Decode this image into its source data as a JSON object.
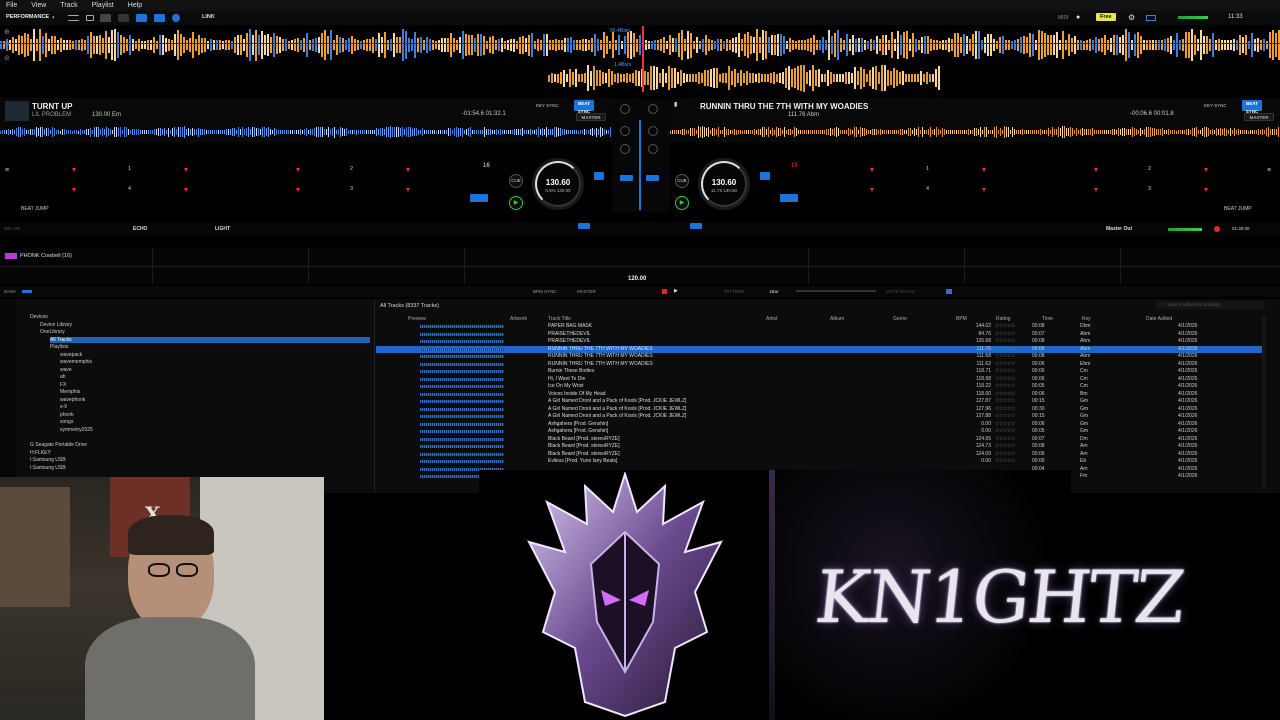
{
  "menu": [
    "File",
    "View",
    "Track",
    "Playlist",
    "Help"
  ],
  "toolbar": {
    "mode": "PERFORMANCE",
    "link": "LINK",
    "midi": "MIDI",
    "free": "Free",
    "clock": "11:33"
  },
  "overview": {
    "bars_top": "56.4Bars",
    "bars_bottom": "1.4Bars"
  },
  "deck_left": {
    "title": "TURNT UP",
    "artist": "LIL PROBLEM",
    "bpm_key": "130.00 Em",
    "time": "-01:54.6  01:32.1",
    "jog_bpm": "130.60",
    "jog_pct": "0.5%  130.00",
    "key_sync": "KEY SYNC",
    "beat_sync": "BEAT SYNC",
    "master": "MASTER",
    "beat_jump": "BEAT JUMP",
    "loop_len": "16"
  },
  "deck_right": {
    "title": "RUNNIN THRU THE 7TH WITH MY WOADIES",
    "bpm_key": "111.76 Abm",
    "time": "-00:06.6  00:01.8",
    "jog_bpm": "130.60",
    "jog_pct": "11.76  130.60",
    "key_sync": "KEY SYNC",
    "beat_sync": "BEAT SYNC",
    "master": "MASTER",
    "beat_jump": "BEAT JUMP",
    "loop_len": "16"
  },
  "cues_left": [
    "1",
    "2",
    "3",
    "4"
  ],
  "cues_right": [
    "1",
    "2",
    "3",
    "4"
  ],
  "fx": {
    "mic": "MIC ON",
    "echo": "ECHO",
    "light": "LIGHT",
    "master_out": "Master Out",
    "rec_time": "01:38:08"
  },
  "sampler": {
    "slot1": "PHONK Cowbell (16)",
    "bpm": "120.00",
    "bank": "BANK",
    "bpm_sync": "BPM SYNC",
    "master": "MASTER",
    "pattern": "PATTERN",
    "bars": "1Bar",
    "mute": "MUTE ERASE"
  },
  "browser": {
    "header": "All Tracks (8337 Tracks)",
    "search_placeholder": "Search within this track list",
    "tree": [
      {
        "label": "Devices",
        "level": 0
      },
      {
        "label": "Device Library",
        "level": 1
      },
      {
        "label": "OneLibrary",
        "level": 1
      },
      {
        "label": "All Tracks",
        "level": 2,
        "selected": true
      },
      {
        "label": "Playlists",
        "level": 2
      },
      {
        "label": "wavepack",
        "level": 3
      },
      {
        "label": "wavememphis",
        "level": 3
      },
      {
        "label": "wave",
        "level": 3
      },
      {
        "label": "ah",
        "level": 3
      },
      {
        "label": "FX",
        "level": 3
      },
      {
        "label": "Memphis",
        "level": 3
      },
      {
        "label": "wavephonk",
        "level": 3
      },
      {
        "label": "e-ll",
        "level": 3
      },
      {
        "label": "phonk",
        "level": 3
      },
      {
        "label": "songs",
        "level": 3
      },
      {
        "label": "symmetry2025",
        "level": 3
      },
      {
        "label": "G Seagate Portable Drive",
        "level": 0
      },
      {
        "label": "H:FLKEY",
        "level": 0
      },
      {
        "label": "I:Samsung USB",
        "level": 0
      },
      {
        "label": "I:Samsung USB",
        "level": 0
      }
    ],
    "columns": [
      "Preview",
      "Artwork",
      "Track Title",
      "Artist",
      "Album",
      "Genre",
      "BPM",
      "Rating",
      "Time",
      "Key",
      "Date Added"
    ],
    "rows": [
      {
        "title": "PAPER BAG MASK",
        "bpm": "144.02",
        "time": "00:08",
        "key": "Dbm",
        "date": "4/1/2026"
      },
      {
        "title": "PRAISETHEDEVIL",
        "bpm": "84.76",
        "time": "00:07",
        "key": "Abm",
        "date": "4/1/2026"
      },
      {
        "title": "PRAISETHEDEVIL",
        "bpm": "126.68",
        "time": "00:08",
        "key": "Abm",
        "date": "4/1/2026"
      },
      {
        "title": "RUNNIN THRU THE 7TH WITH MY WOADIES",
        "bpm": "111.76",
        "time": "00:06",
        "key": "Abm",
        "date": "4/1/2026",
        "selected": true
      },
      {
        "title": "RUNNIN THRU THE 7TH WITH MY WOADIES",
        "bpm": "111.68",
        "time": "00:08",
        "key": "Abm",
        "date": "4/1/2026"
      },
      {
        "title": "RUNNIN THRU THE 7TH WITH MY WOADIES",
        "bpm": "111.62",
        "time": "00:06",
        "key": "Ebm",
        "date": "4/1/2026"
      },
      {
        "title": "Burnin These Bodies",
        "bpm": "118.71",
        "time": "00:06",
        "key": "Cm",
        "date": "4/1/2026"
      },
      {
        "title": "Hi, I Want To Die",
        "bpm": "118.08",
        "time": "00:06",
        "key": "Cm",
        "date": "4/1/2026"
      },
      {
        "title": "Ice On My Wrist",
        "bpm": "118.22",
        "time": "00:05",
        "key": "Cm",
        "date": "4/1/2026"
      },
      {
        "title": "Voices Inside Of My Head",
        "bpm": "118.00",
        "time": "00:06",
        "key": "Bm",
        "date": "4/1/2026"
      },
      {
        "title": "A Girl Named Drool and a Pack of Kools [Prod. JCKIE JEWLZ]",
        "bpm": "127.87",
        "time": "00:15",
        "key": "Gm",
        "date": "4/1/2026"
      },
      {
        "title": "A Girl Named Drool and a Pack of Kools [Prod. JCKIE JEWLZ]",
        "bpm": "127.96",
        "time": "00:30",
        "key": "Gm",
        "date": "4/1/2026"
      },
      {
        "title": "A Girl Named Drool and a Pack of Kools [Prod. JCKIE JEWLZ]",
        "bpm": "127.88",
        "time": "00:15",
        "key": "Gm",
        "date": "4/1/2026"
      },
      {
        "title": "Ashgahera [Prod. Genshin]",
        "bpm": "0.00",
        "time": "00:06",
        "key": "Gm",
        "date": "4/1/2026"
      },
      {
        "title": "Ashgahera [Prod. Genshin]",
        "bpm": "0.00",
        "time": "00:05",
        "key": "Gm",
        "date": "4/1/2026"
      },
      {
        "title": "Black Beard [Prod. stereoRYZE]",
        "bpm": "124.65",
        "time": "00:07",
        "key": "Dm",
        "date": "4/1/2026"
      },
      {
        "title": "Black Beard [Prod. stereoRYZE]",
        "bpm": "124.73",
        "time": "00:08",
        "key": "Am",
        "date": "4/1/2026"
      },
      {
        "title": "Black Beard [Prod. stereoRYZE]",
        "bpm": "124.09",
        "time": "00:06",
        "key": "Am",
        "date": "4/1/2026"
      },
      {
        "title": "Eviless [Prod. Yuno Isey Beats]",
        "bpm": "0.00",
        "time": "00:05",
        "key": "Eb",
        "date": "4/1/2026"
      },
      {
        "title": "",
        "bpm": "",
        "time": "00:04",
        "key": "Am",
        "date": "4/1/2026"
      },
      {
        "title": "",
        "bpm": "",
        "time": "00:01",
        "key": "Fm",
        "date": "4/1/2026"
      }
    ]
  },
  "overlay": {
    "logo_text": "KN1GHTZ"
  },
  "colors": {
    "accent": "#1d74d8",
    "wave_orange": "#f0a030",
    "wave_blue": "#3d7fdc",
    "selection": "#1e67c9",
    "rec": "#e0282a"
  }
}
